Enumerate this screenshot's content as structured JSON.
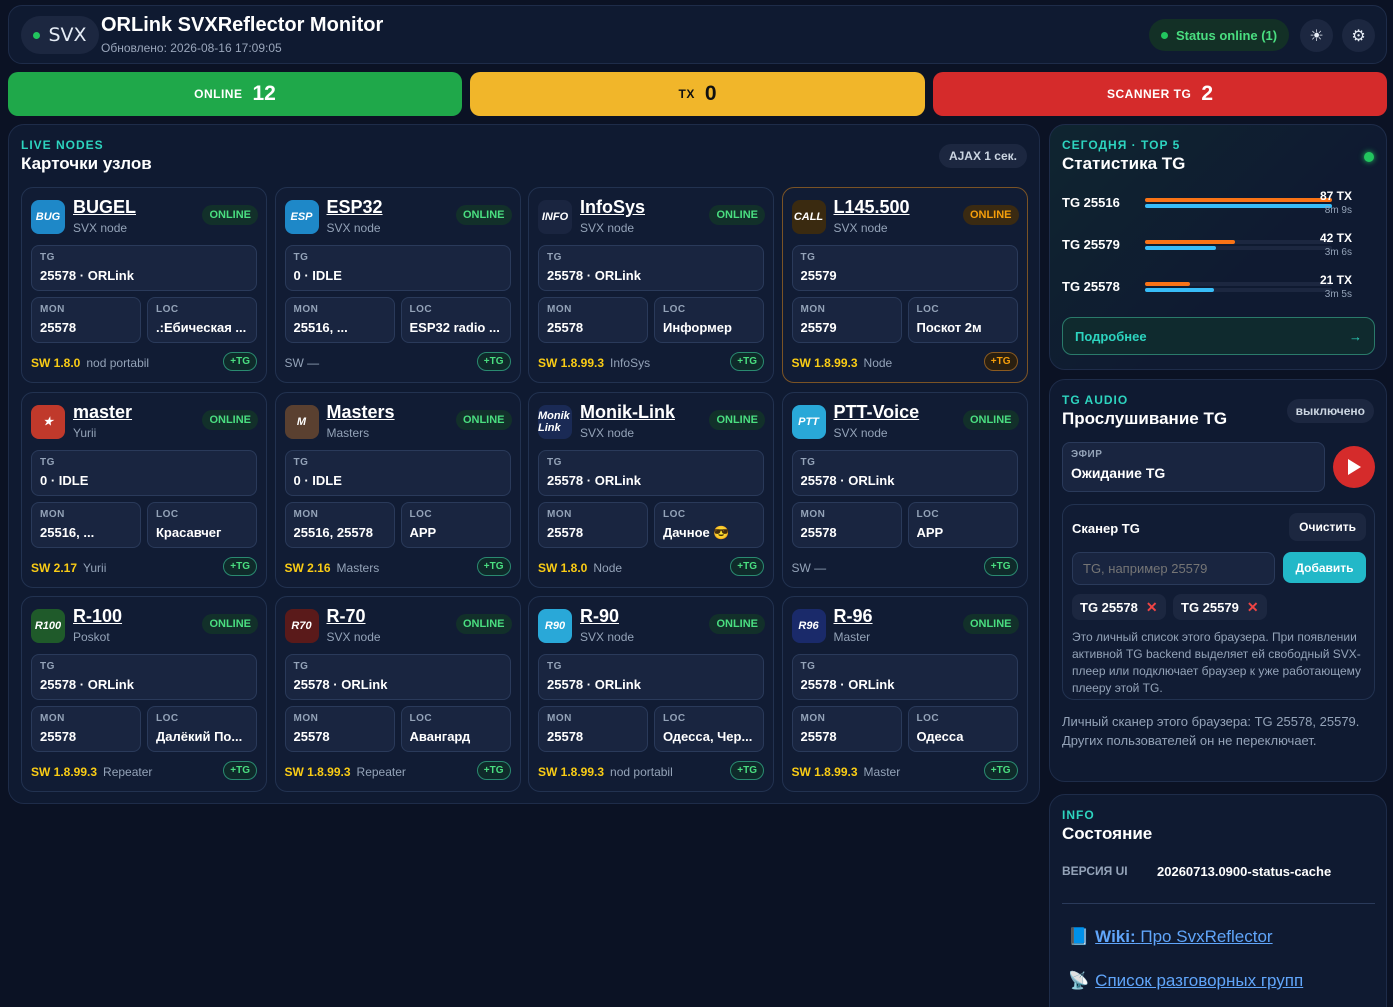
{
  "header": {
    "logo_text": "SVX",
    "title": "ORLink SVXReflector Monitor",
    "updated": "Обновлено: 2026-08-16 17:09:05",
    "status": "Status online (1)",
    "theme_icon": "sun-icon",
    "settings_icon": "gear-icon"
  },
  "stats": {
    "online": {
      "label": "ONLINE",
      "value": "12",
      "color": "#1fa84a"
    },
    "tx": {
      "label": "TX",
      "value": "0",
      "color": "#f1b62a"
    },
    "scanner": {
      "label": "SCANNER TG",
      "value": "2",
      "color": "#d52b2b"
    }
  },
  "nodes_panel": {
    "kicker": "LIVE NODES",
    "title": "Карточки узлов",
    "ajax": "AJAX 1 сек."
  },
  "labels": {
    "tg": "TG",
    "mon": "MON",
    "loc": "LOC",
    "tg_button": "+TG"
  },
  "nodes": [
    {
      "name": "BUGEL",
      "sub": "SVX node",
      "badge": "ONLINE",
      "avatar": "BUG",
      "tg": "25578 · ORLink",
      "mon": "25578",
      "loc": ".:Ебическая ...",
      "sw": "SW 1.8.0",
      "note": "nod portabil"
    },
    {
      "name": "ESP32",
      "sub": "SVX node",
      "badge": "ONLINE",
      "avatar": "ESP",
      "tg": "0 · IDLE",
      "mon": "25516, ...",
      "loc": "ESP32 radio ...",
      "sw": "",
      "note": "SW —"
    },
    {
      "name": "InfoSys",
      "sub": "SVX node",
      "badge": "ONLINE",
      "avatar": "INFO",
      "tg": "25578 · ORLink",
      "mon": "25578",
      "loc": "Информер",
      "sw": "SW 1.8.99.3",
      "note": "InfoSys"
    },
    {
      "name": "L145.500",
      "sub": "SVX node",
      "badge": "ONLINE",
      "avatar": "CALL",
      "tg": "25579",
      "mon": "25579",
      "loc": "Поскот 2м",
      "sw": "SW 1.8.99.3",
      "note": "Node"
    },
    {
      "name": "master",
      "sub": "Yurii",
      "badge": "ONLINE",
      "avatar": "★",
      "tg": "0 · IDLE",
      "mon": "25516, ...",
      "loc": "Красавчег",
      "sw": "SW 2.17",
      "note": "Yurii"
    },
    {
      "name": "Masters",
      "sub": "Masters",
      "badge": "ONLINE",
      "avatar": "M",
      "tg": "0 · IDLE",
      "mon": "25516, 25578",
      "loc": "APP",
      "sw": "SW 2.16",
      "note": "Masters"
    },
    {
      "name": "Monik-Link",
      "sub": "SVX node",
      "badge": "ONLINE",
      "avatar": "Monik Link",
      "tg": "25578 · ORLink",
      "mon": "25578",
      "loc": "Дачное 😎",
      "sw": "SW 1.8.0",
      "note": "Node"
    },
    {
      "name": "PTT-Voice",
      "sub": "SVX node",
      "badge": "ONLINE",
      "avatar": "PTT",
      "tg": "25578 · ORLink",
      "mon": "25578",
      "loc": "APP",
      "sw": "",
      "note": "SW —"
    },
    {
      "name": "R-100",
      "sub": "Poskot",
      "badge": "ONLINE",
      "avatar": "R100",
      "tg": "25578 · ORLink",
      "mon": "25578",
      "loc": "Далёкий По...",
      "sw": "SW 1.8.99.3",
      "note": "Repeater"
    },
    {
      "name": "R-70",
      "sub": "SVX node",
      "badge": "ONLINE",
      "avatar": "R70",
      "tg": "25578 · ORLink",
      "mon": "25578",
      "loc": "Авангард",
      "sw": "SW 1.8.99.3",
      "note": "Repeater"
    },
    {
      "name": "R-90",
      "sub": "SVX node",
      "badge": "ONLINE",
      "avatar": "R90",
      "tg": "25578 · ORLink",
      "mon": "25578",
      "loc": "Одесса, Чер...",
      "sw": "SW 1.8.99.3",
      "note": "nod portabil"
    },
    {
      "name": "R-96",
      "sub": "Master",
      "badge": "ONLINE",
      "avatar": "R96",
      "tg": "25578 · ORLink",
      "mon": "25578",
      "loc": "Одесса",
      "sw": "SW 1.8.99.3",
      "note": "Master"
    }
  ],
  "top5": {
    "kicker": "СЕГОДНЯ · TOP 5",
    "title": "Статистика TG",
    "rows": [
      {
        "tg": "TG 25516",
        "count": "87 TX",
        "duration": "8m 9s",
        "tx_share": 1.0,
        "time_share": 1.0
      },
      {
        "tg": "TG 25579",
        "count": "42 TX",
        "duration": "3m 6s",
        "tx_share": 0.48,
        "time_share": 0.38
      },
      {
        "tg": "TG 25578",
        "count": "21 TX",
        "duration": "3m 5s",
        "tx_share": 0.24,
        "time_share": 0.37
      }
    ],
    "more": "Подробнее",
    "more_arrow": "→"
  },
  "audio": {
    "kicker": "TG AUDIO",
    "title": "Прослушивание TG",
    "state": "выключено",
    "ether_label": "ЭФИР",
    "ether_value": "Ожидание TG",
    "scanner_title": "Сканер TG",
    "clear": "Очистить",
    "input_placeholder": "TG, например 25579",
    "add": "Добавить",
    "chips": [
      "TG 25578",
      "TG 25579"
    ],
    "note": "Это личный список этого браузера. При появлении активной TG backend выделяет ей свободный SVX-плеер или подключает браузер к уже работающему плееру этой TG.",
    "personal": "Личный сканер этого браузера: TG 25578, 25579. Других пользователей он не переключает."
  },
  "info": {
    "kicker": "INFO",
    "title": "Состояние",
    "version_label": "ВЕРСИЯ UI",
    "version_value": "20260713.0900-status-cache",
    "wiki_bold": "Wiki:",
    "wiki_text": "Про SvxReflector",
    "groups": "Список разговорных групп"
  }
}
